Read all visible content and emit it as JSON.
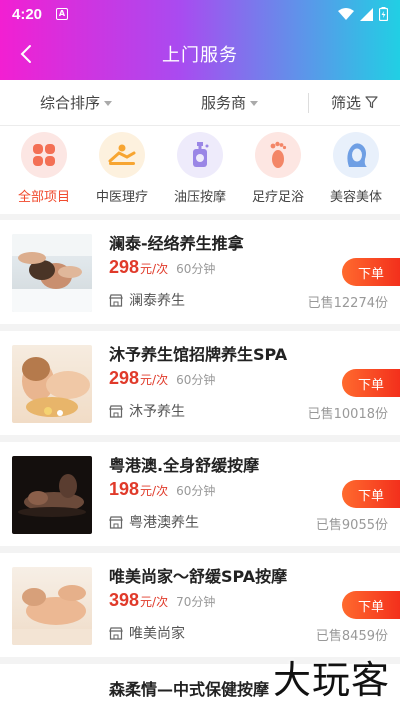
{
  "status": {
    "time": "4:20",
    "a_badge": "A"
  },
  "nav": {
    "title": "上门服务"
  },
  "filters": {
    "sort": "综合排序",
    "provider": "服务商",
    "filter": "筛选"
  },
  "categories": [
    {
      "label": "全部项目",
      "icon": "grid-icon",
      "bg": "#fce6e3",
      "color": "#f37055"
    },
    {
      "label": "中医理疗",
      "icon": "therapy-icon",
      "bg": "#fdf1de",
      "color": "#f7a531"
    },
    {
      "label": "油压按摩",
      "icon": "oil-bottle-icon",
      "bg": "#eeebfb",
      "color": "#9a86e6"
    },
    {
      "label": "足疗足浴",
      "icon": "foot-icon",
      "bg": "#fde6e2",
      "color": "#f38667"
    },
    {
      "label": "美容美体",
      "icon": "face-icon",
      "bg": "#e8f0fb",
      "color": "#6f9fe4"
    }
  ],
  "items": [
    {
      "name": "澜泰-经络养生推拿",
      "price": "298",
      "unit": "元/次",
      "duration": "60分钟",
      "shop": "澜泰养生",
      "sold": "已售12274份",
      "order": "下单"
    },
    {
      "name": "沐予养生馆招牌养生SPA",
      "price": "298",
      "unit": "元/次",
      "duration": "60分钟",
      "shop": "沐予养生",
      "sold": "已售10018份",
      "order": "下单"
    },
    {
      "name": "粤港澳.全身舒缓按摩",
      "price": "198",
      "unit": "元/次",
      "duration": "60分钟",
      "shop": "粤港澳养生",
      "sold": "已售9055份",
      "order": "下单"
    },
    {
      "name": "唯美尚家～舒缓SPA按摩",
      "price": "398",
      "unit": "元/次",
      "duration": "70分钟",
      "shop": "唯美尚家",
      "sold": "已售8459份",
      "order": "下单"
    }
  ],
  "partial_item": {
    "name": "森柔情—中式保健按摩"
  },
  "watermark": "大玩客",
  "colors": {
    "accent_red": "#e03a2a",
    "order_button": "#f3301c",
    "header_gradient": [
      "#f21fd2",
      "#a94bf0",
      "#21cfe4"
    ]
  }
}
